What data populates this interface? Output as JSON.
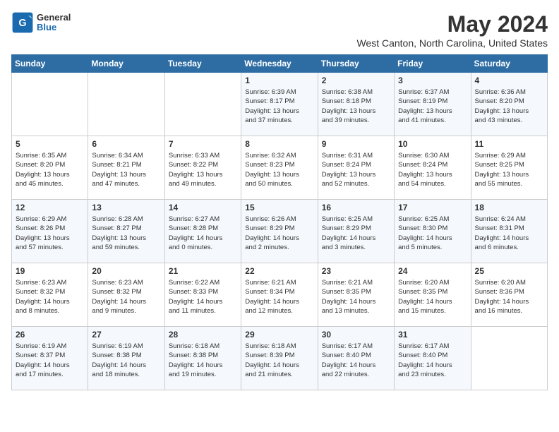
{
  "header": {
    "logo": {
      "general": "General",
      "blue": "Blue"
    },
    "title": "May 2024",
    "location": "West Canton, North Carolina, United States"
  },
  "days_of_week": [
    "Sunday",
    "Monday",
    "Tuesday",
    "Wednesday",
    "Thursday",
    "Friday",
    "Saturday"
  ],
  "weeks": [
    [
      {
        "num": "",
        "text": ""
      },
      {
        "num": "",
        "text": ""
      },
      {
        "num": "",
        "text": ""
      },
      {
        "num": "1",
        "text": "Sunrise: 6:39 AM\nSunset: 8:17 PM\nDaylight: 13 hours\nand 37 minutes."
      },
      {
        "num": "2",
        "text": "Sunrise: 6:38 AM\nSunset: 8:18 PM\nDaylight: 13 hours\nand 39 minutes."
      },
      {
        "num": "3",
        "text": "Sunrise: 6:37 AM\nSunset: 8:19 PM\nDaylight: 13 hours\nand 41 minutes."
      },
      {
        "num": "4",
        "text": "Sunrise: 6:36 AM\nSunset: 8:20 PM\nDaylight: 13 hours\nand 43 minutes."
      }
    ],
    [
      {
        "num": "5",
        "text": "Sunrise: 6:35 AM\nSunset: 8:20 PM\nDaylight: 13 hours\nand 45 minutes."
      },
      {
        "num": "6",
        "text": "Sunrise: 6:34 AM\nSunset: 8:21 PM\nDaylight: 13 hours\nand 47 minutes."
      },
      {
        "num": "7",
        "text": "Sunrise: 6:33 AM\nSunset: 8:22 PM\nDaylight: 13 hours\nand 49 minutes."
      },
      {
        "num": "8",
        "text": "Sunrise: 6:32 AM\nSunset: 8:23 PM\nDaylight: 13 hours\nand 50 minutes."
      },
      {
        "num": "9",
        "text": "Sunrise: 6:31 AM\nSunset: 8:24 PM\nDaylight: 13 hours\nand 52 minutes."
      },
      {
        "num": "10",
        "text": "Sunrise: 6:30 AM\nSunset: 8:24 PM\nDaylight: 13 hours\nand 54 minutes."
      },
      {
        "num": "11",
        "text": "Sunrise: 6:29 AM\nSunset: 8:25 PM\nDaylight: 13 hours\nand 55 minutes."
      }
    ],
    [
      {
        "num": "12",
        "text": "Sunrise: 6:29 AM\nSunset: 8:26 PM\nDaylight: 13 hours\nand 57 minutes."
      },
      {
        "num": "13",
        "text": "Sunrise: 6:28 AM\nSunset: 8:27 PM\nDaylight: 13 hours\nand 59 minutes."
      },
      {
        "num": "14",
        "text": "Sunrise: 6:27 AM\nSunset: 8:28 PM\nDaylight: 14 hours\nand 0 minutes."
      },
      {
        "num": "15",
        "text": "Sunrise: 6:26 AM\nSunset: 8:29 PM\nDaylight: 14 hours\nand 2 minutes."
      },
      {
        "num": "16",
        "text": "Sunrise: 6:25 AM\nSunset: 8:29 PM\nDaylight: 14 hours\nand 3 minutes."
      },
      {
        "num": "17",
        "text": "Sunrise: 6:25 AM\nSunset: 8:30 PM\nDaylight: 14 hours\nand 5 minutes."
      },
      {
        "num": "18",
        "text": "Sunrise: 6:24 AM\nSunset: 8:31 PM\nDaylight: 14 hours\nand 6 minutes."
      }
    ],
    [
      {
        "num": "19",
        "text": "Sunrise: 6:23 AM\nSunset: 8:32 PM\nDaylight: 14 hours\nand 8 minutes."
      },
      {
        "num": "20",
        "text": "Sunrise: 6:23 AM\nSunset: 8:32 PM\nDaylight: 14 hours\nand 9 minutes."
      },
      {
        "num": "21",
        "text": "Sunrise: 6:22 AM\nSunset: 8:33 PM\nDaylight: 14 hours\nand 11 minutes."
      },
      {
        "num": "22",
        "text": "Sunrise: 6:21 AM\nSunset: 8:34 PM\nDaylight: 14 hours\nand 12 minutes."
      },
      {
        "num": "23",
        "text": "Sunrise: 6:21 AM\nSunset: 8:35 PM\nDaylight: 14 hours\nand 13 minutes."
      },
      {
        "num": "24",
        "text": "Sunrise: 6:20 AM\nSunset: 8:35 PM\nDaylight: 14 hours\nand 15 minutes."
      },
      {
        "num": "25",
        "text": "Sunrise: 6:20 AM\nSunset: 8:36 PM\nDaylight: 14 hours\nand 16 minutes."
      }
    ],
    [
      {
        "num": "26",
        "text": "Sunrise: 6:19 AM\nSunset: 8:37 PM\nDaylight: 14 hours\nand 17 minutes."
      },
      {
        "num": "27",
        "text": "Sunrise: 6:19 AM\nSunset: 8:38 PM\nDaylight: 14 hours\nand 18 minutes."
      },
      {
        "num": "28",
        "text": "Sunrise: 6:18 AM\nSunset: 8:38 PM\nDaylight: 14 hours\nand 19 minutes."
      },
      {
        "num": "29",
        "text": "Sunrise: 6:18 AM\nSunset: 8:39 PM\nDaylight: 14 hours\nand 21 minutes."
      },
      {
        "num": "30",
        "text": "Sunrise: 6:17 AM\nSunset: 8:40 PM\nDaylight: 14 hours\nand 22 minutes."
      },
      {
        "num": "31",
        "text": "Sunrise: 6:17 AM\nSunset: 8:40 PM\nDaylight: 14 hours\nand 23 minutes."
      },
      {
        "num": "",
        "text": ""
      }
    ]
  ]
}
